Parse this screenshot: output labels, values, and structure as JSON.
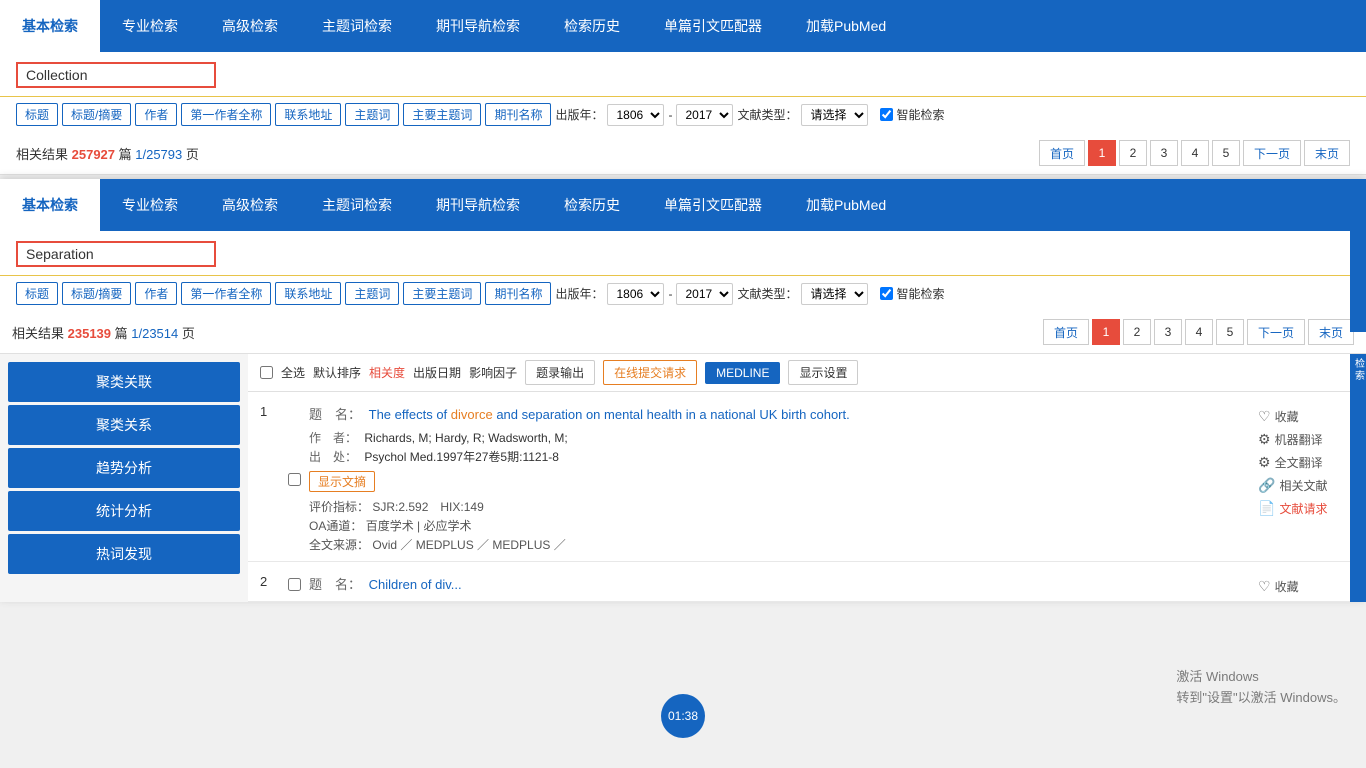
{
  "top_nav": {
    "items": [
      {
        "label": "基本检索",
        "active": true
      },
      {
        "label": "专业检索",
        "active": false
      },
      {
        "label": "高级检索",
        "active": false
      },
      {
        "label": "主题词检索",
        "active": false
      },
      {
        "label": "期刊导航检索",
        "active": false
      },
      {
        "label": "检索历史",
        "active": false
      },
      {
        "label": "单篇引文匹配器",
        "active": false
      },
      {
        "label": "加载PubMed",
        "active": false
      }
    ]
  },
  "top_section": {
    "search_text": "Collection",
    "filter_tags": [
      "标题",
      "标题/摘要",
      "作者",
      "第一作者全称",
      "联系地址",
      "主题词",
      "主要主题词",
      "期刊名称"
    ],
    "year_from": "1806",
    "year_to": "2017",
    "doc_type_label": "文献类型：",
    "doc_type_placeholder": "请选择",
    "smart_search": "智能检索",
    "results_count": "257927",
    "results_pages": "25793",
    "pagination": [
      "首页",
      "1",
      "2",
      "3",
      "4",
      "5",
      "下一页",
      "末页"
    ],
    "year_label": "出版年：",
    "year_dash": "-"
  },
  "bottom_nav": {
    "items": [
      {
        "label": "基本检索",
        "active": true
      },
      {
        "label": "专业检索",
        "active": false
      },
      {
        "label": "高级检索",
        "active": false
      },
      {
        "label": "主题词检索",
        "active": false
      },
      {
        "label": "期刊导航检索",
        "active": false
      },
      {
        "label": "检索历史",
        "active": false
      },
      {
        "label": "单篇引文匹配器",
        "active": false
      },
      {
        "label": "加载PubMed",
        "active": false
      }
    ]
  },
  "bottom_section": {
    "search_text": "Separation",
    "filter_tags": [
      "标题",
      "标题/摘要",
      "作者",
      "第一作者全称",
      "联系地址",
      "主题词",
      "主要主题词",
      "期刊名称"
    ],
    "year_from": "1806",
    "year_to": "2017",
    "doc_type_label": "文献类型：",
    "doc_type_placeholder": "请选择",
    "smart_search": "智能检索",
    "results_count": "235139",
    "results_pages": "23514",
    "pagination": [
      "首页",
      "1",
      "2",
      "3",
      "4",
      "5",
      "下一页",
      "末页"
    ],
    "year_label": "出版年：",
    "year_dash": "-"
  },
  "sidebar": {
    "buttons": [
      "聚类关联",
      "聚类关系",
      "趋势分析",
      "统计分析",
      "热词发现"
    ]
  },
  "toolbar": {
    "select_all": "全选",
    "default_sort": "默认排序",
    "relevance": "相关度",
    "pub_date": "出版日期",
    "impact_factor": "影响因子",
    "export_records": "题录输出",
    "online_submit": "在线提交请求",
    "medline": "MEDLINE",
    "display_settings": "显示设置"
  },
  "article": {
    "num": "1",
    "title_label": "题　名：",
    "title_text": "The effects of ",
    "title_highlight1": "divorce",
    "title_mid1": " and ",
    "title_highlight2": "separation",
    "title_end": " on mental health in a national UK birth cohort.",
    "author_label": "作　者：",
    "author_text": "Richards, M; Hardy, R; Wadsworth, M;",
    "source_label": "出　处：",
    "source_text": "Psychol Med.1997年27卷5期:1121-8",
    "show_abstract": "显示文摘",
    "metric_label": "评价指标：",
    "metric_text": "SJR:2.592　HIX:149",
    "oa_label": "OA通道：",
    "oa_text": "百度学术 | 必应学术",
    "fulltext_label": "全文来源：",
    "fulltext_text": "Ovid ／ MEDPLUS ／ MEDPLUS ／",
    "actions": {
      "bookmark": "收藏",
      "machine_translate": "机器翻译",
      "full_translate": "全文翻译",
      "related": "相关文献",
      "request": "文献请求"
    }
  },
  "article2_partial": {
    "num": "2",
    "title_label": "题　名：",
    "title_partial": "Children of div..."
  },
  "timer": "01:38",
  "win_activate": {
    "line1": "激活 Windows",
    "line2": "转到\"设置\"以激活 Windows。"
  }
}
